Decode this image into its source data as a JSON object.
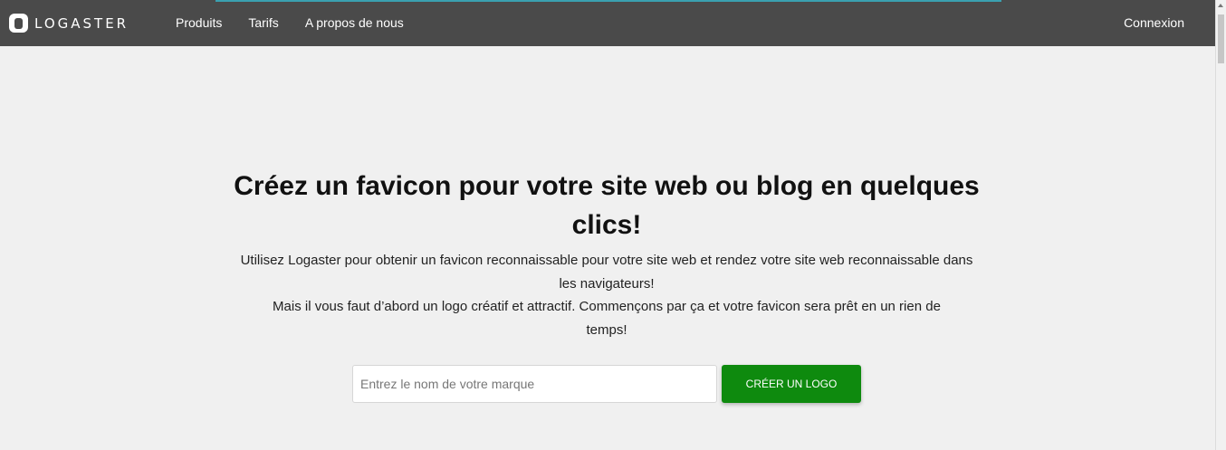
{
  "header": {
    "logo_text": "LOGASTER",
    "nav": [
      {
        "label": "Produits"
      },
      {
        "label": "Tarifs"
      },
      {
        "label": "A propos de nous"
      }
    ],
    "login_label": "Connexion"
  },
  "hero": {
    "title": "Créez un favicon pour votre site web ou blog en quelques clics!",
    "paragraph_1": "Utilisez Logaster pour obtenir un favicon reconnaissable pour votre site web et rendez votre site web reconnaissable dans les navigateurs!",
    "paragraph_2": "Mais il vous faut d’abord un logo créatif et attractif. Commençons par ça et votre favicon sera prêt en un rien de temps!"
  },
  "form": {
    "input_value": "",
    "input_placeholder": "Entrez le nom de votre marque",
    "button_label": "CRÉER UN LOGO"
  },
  "colors": {
    "header_bg": "#4a4a4a",
    "page_bg": "#f0f0f0",
    "cta_green": "#0e8a0e"
  },
  "icons": {
    "logo": "logaster-logo-icon"
  }
}
